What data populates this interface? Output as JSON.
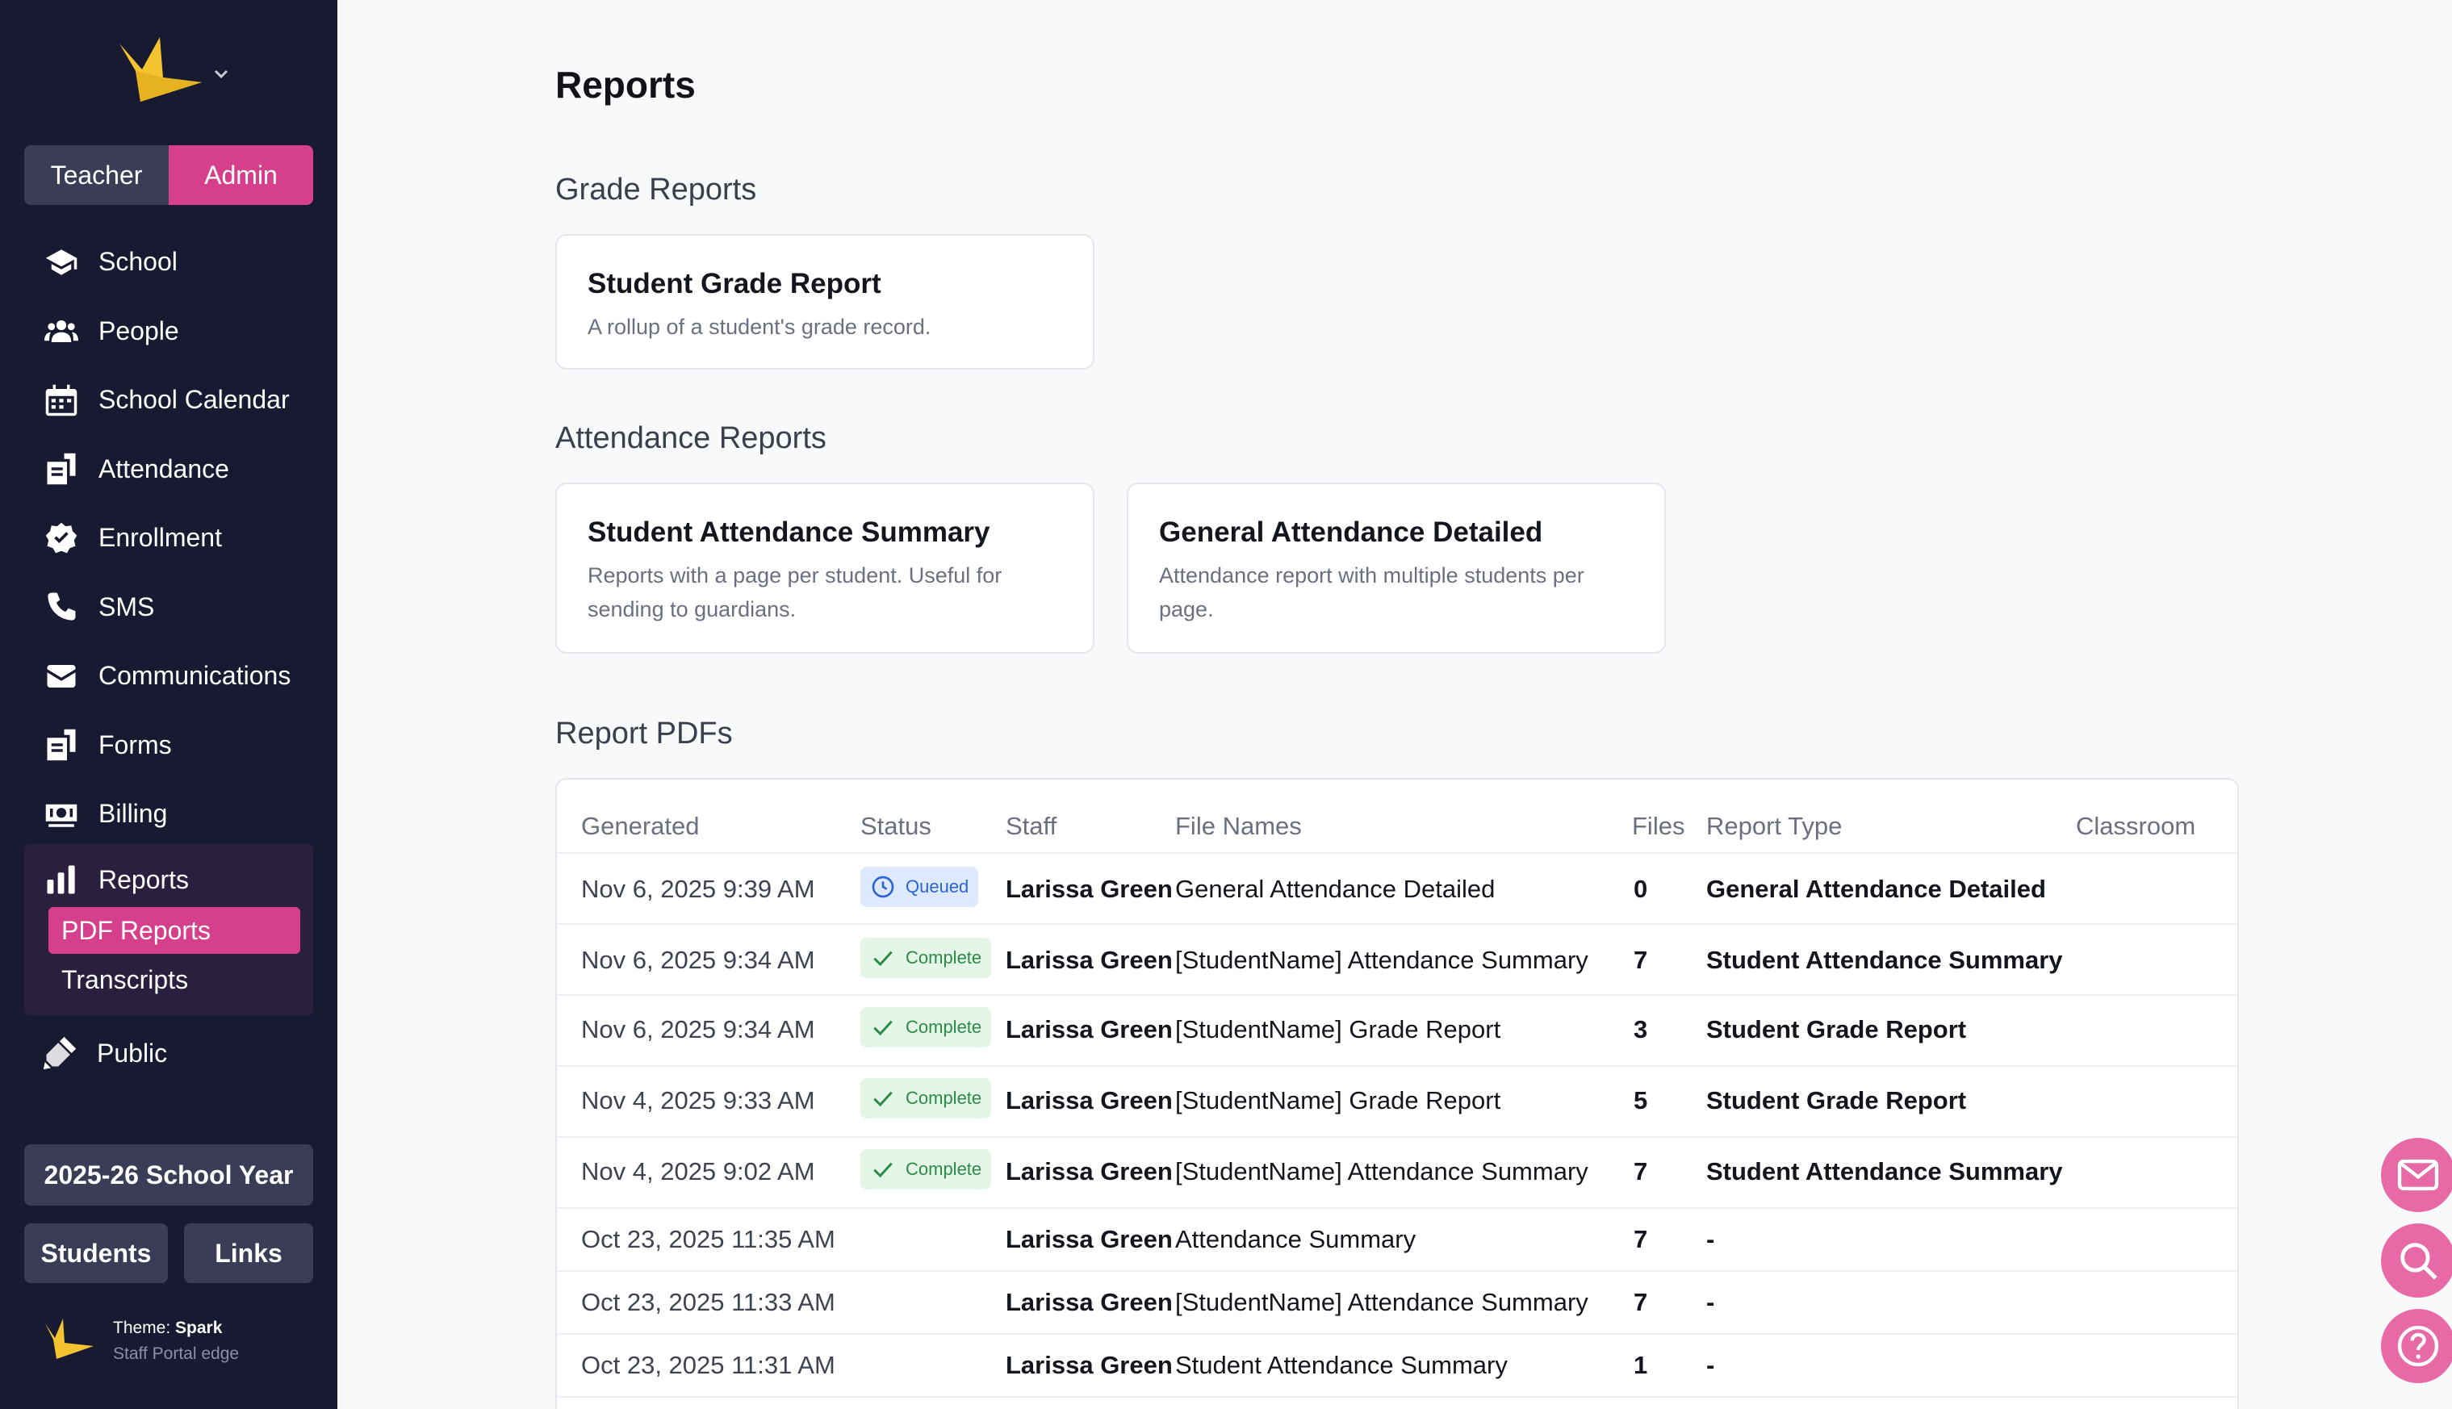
{
  "sidebar": {
    "role_toggle": {
      "teacher": "Teacher",
      "admin": "Admin"
    },
    "nav": [
      {
        "label": "School",
        "icon": "graduation-cap-icon"
      },
      {
        "label": "People",
        "icon": "users-icon"
      },
      {
        "label": "School Calendar",
        "icon": "calendar-icon"
      },
      {
        "label": "Attendance",
        "icon": "clipboard-icon"
      },
      {
        "label": "Enrollment",
        "icon": "badge-check-icon"
      },
      {
        "label": "SMS",
        "icon": "phone-icon"
      },
      {
        "label": "Communications",
        "icon": "envelope-icon"
      },
      {
        "label": "Forms",
        "icon": "forms-icon"
      },
      {
        "label": "Billing",
        "icon": "money-icon"
      }
    ],
    "reports": {
      "label": "Reports",
      "sub_pdf": "PDF Reports",
      "sub_transcripts": "Transcripts"
    },
    "public": "Public",
    "school_year": "2025-26 School Year",
    "students": "Students",
    "links": "Links",
    "theme_prefix": "Theme: ",
    "theme_name": "Spark",
    "theme_sub": "Staff Portal edge"
  },
  "main": {
    "title": "Reports",
    "grade_section": "Grade Reports",
    "attendance_section": "Attendance Reports",
    "pdf_section": "Report PDFs",
    "cards": {
      "student_grade": {
        "title": "Student Grade Report",
        "desc": "A rollup of a student's grade record."
      },
      "attendance_summary": {
        "title": "Student Attendance Summary",
        "desc1": "Reports with a page per student. Useful for",
        "desc2": "sending to guardians."
      },
      "general_attendance": {
        "title": "General Attendance Detailed",
        "desc1": "Attendance report with multiple students per",
        "desc2": "page."
      }
    },
    "table": {
      "headers": {
        "generated": "Generated",
        "status": "Status",
        "staff": "Staff",
        "file_names": "File Names",
        "files": "Files",
        "report_type": "Report Type",
        "classroom": "Classroom"
      },
      "rows": [
        {
          "generated": "Nov 6, 2025 9:39 AM",
          "status": "Queued",
          "staff": "Larissa Green",
          "file_names": "General Attendance Detailed",
          "files": "0",
          "report_type": "General Attendance Detailed"
        },
        {
          "generated": "Nov 6, 2025 9:34 AM",
          "status": "Complete",
          "staff": "Larissa Green",
          "file_names": "[StudentName] Attendance Summary",
          "files": "7",
          "report_type": "Student Attendance Summary"
        },
        {
          "generated": "Nov 6, 2025 9:34 AM",
          "status": "Complete",
          "staff": "Larissa Green",
          "file_names": "[StudentName] Grade Report",
          "files": "3",
          "report_type": "Student Grade Report"
        },
        {
          "generated": "Nov 4, 2025 9:33 AM",
          "status": "Complete",
          "staff": "Larissa Green",
          "file_names": "[StudentName] Grade Report",
          "files": "5",
          "report_type": "Student Grade Report"
        },
        {
          "generated": "Nov 4, 2025 9:02 AM",
          "status": "Complete",
          "staff": "Larissa Green",
          "file_names": "[StudentName] Attendance Summary",
          "files": "7",
          "report_type": "Student Attendance Summary"
        },
        {
          "generated": "Oct 23, 2025 11:35 AM",
          "status": "",
          "staff": "Larissa Green",
          "file_names": "Attendance Summary",
          "files": "7",
          "report_type": "-"
        },
        {
          "generated": "Oct 23, 2025 11:33 AM",
          "status": "",
          "staff": "Larissa Green",
          "file_names": "[StudentName] Attendance Summary",
          "files": "7",
          "report_type": "-"
        },
        {
          "generated": "Oct 23, 2025 11:31 AM",
          "status": "",
          "staff": "Larissa Green",
          "file_names": "Student Attendance Summary",
          "files": "1",
          "report_type": "-"
        }
      ]
    }
  },
  "colors": {
    "sidebar_bg": "#171a30",
    "accent": "#d63f8c",
    "fab": "#e76aa6",
    "queued": "#2f63d6",
    "complete": "#2b8a44"
  },
  "floating": {
    "icons": [
      "envelope-icon",
      "search-icon",
      "help-icon"
    ]
  }
}
